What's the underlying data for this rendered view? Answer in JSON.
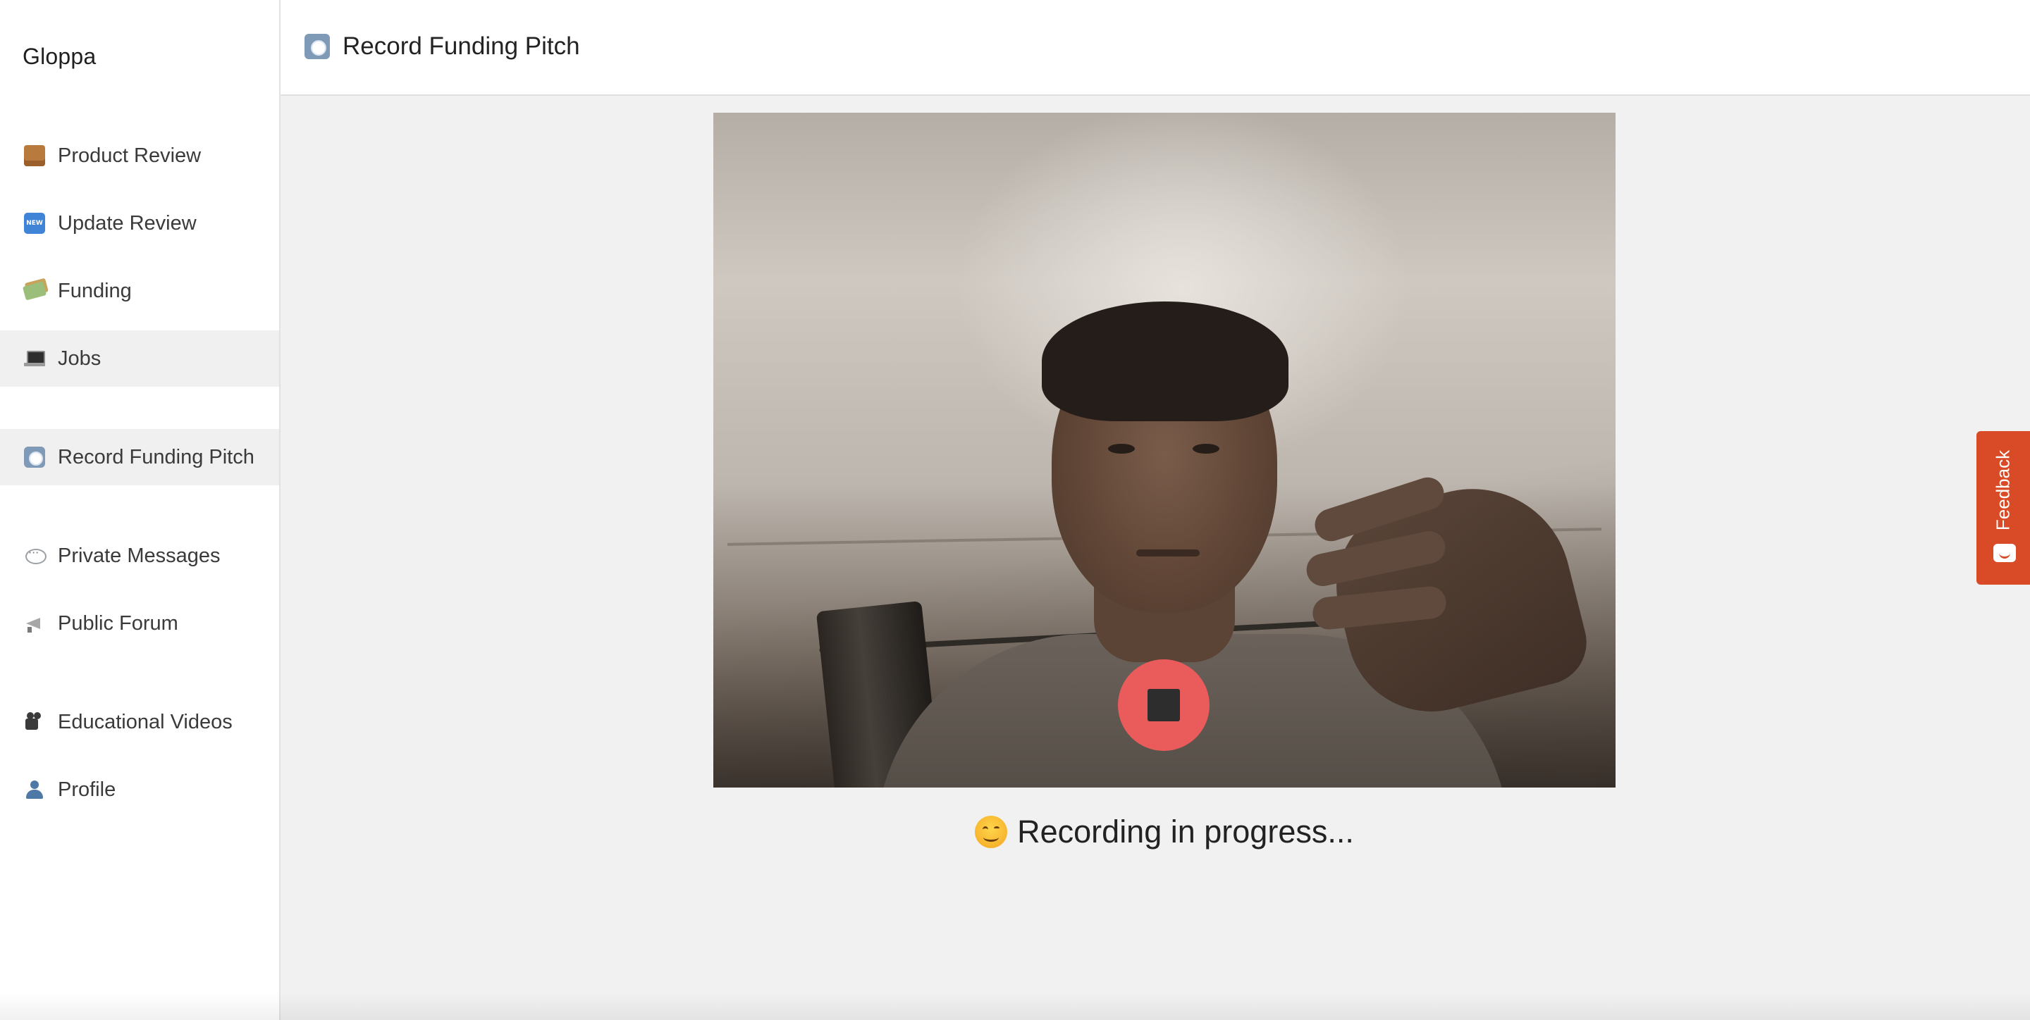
{
  "app": {
    "brand": "Gloppa"
  },
  "sidebar": {
    "items": [
      {
        "label": "Product Review",
        "icon": "package-icon"
      },
      {
        "label": "Update Review",
        "icon": "new-badge-icon"
      },
      {
        "label": "Funding",
        "icon": "money-icon"
      },
      {
        "label": "Jobs",
        "icon": "laptop-icon",
        "active": true
      },
      {
        "label": "Record Funding Pitch",
        "icon": "record-button-icon",
        "active": true
      },
      {
        "label": "Private Messages",
        "icon": "speech-bubble-icon"
      },
      {
        "label": "Public Forum",
        "icon": "megaphone-icon"
      },
      {
        "label": "Educational Videos",
        "icon": "movie-camera-icon"
      },
      {
        "label": "Profile",
        "icon": "person-icon"
      }
    ]
  },
  "header": {
    "title": "Record Funding Pitch",
    "icon": "record-button-icon"
  },
  "recorder": {
    "status_text": "Recording in progress...",
    "status_emoji": "smiling-face-icon",
    "stop_button": "stop-icon",
    "accent_color": "#ea5b5b"
  },
  "feedback": {
    "label": "Feedback",
    "color": "#d94a26"
  }
}
